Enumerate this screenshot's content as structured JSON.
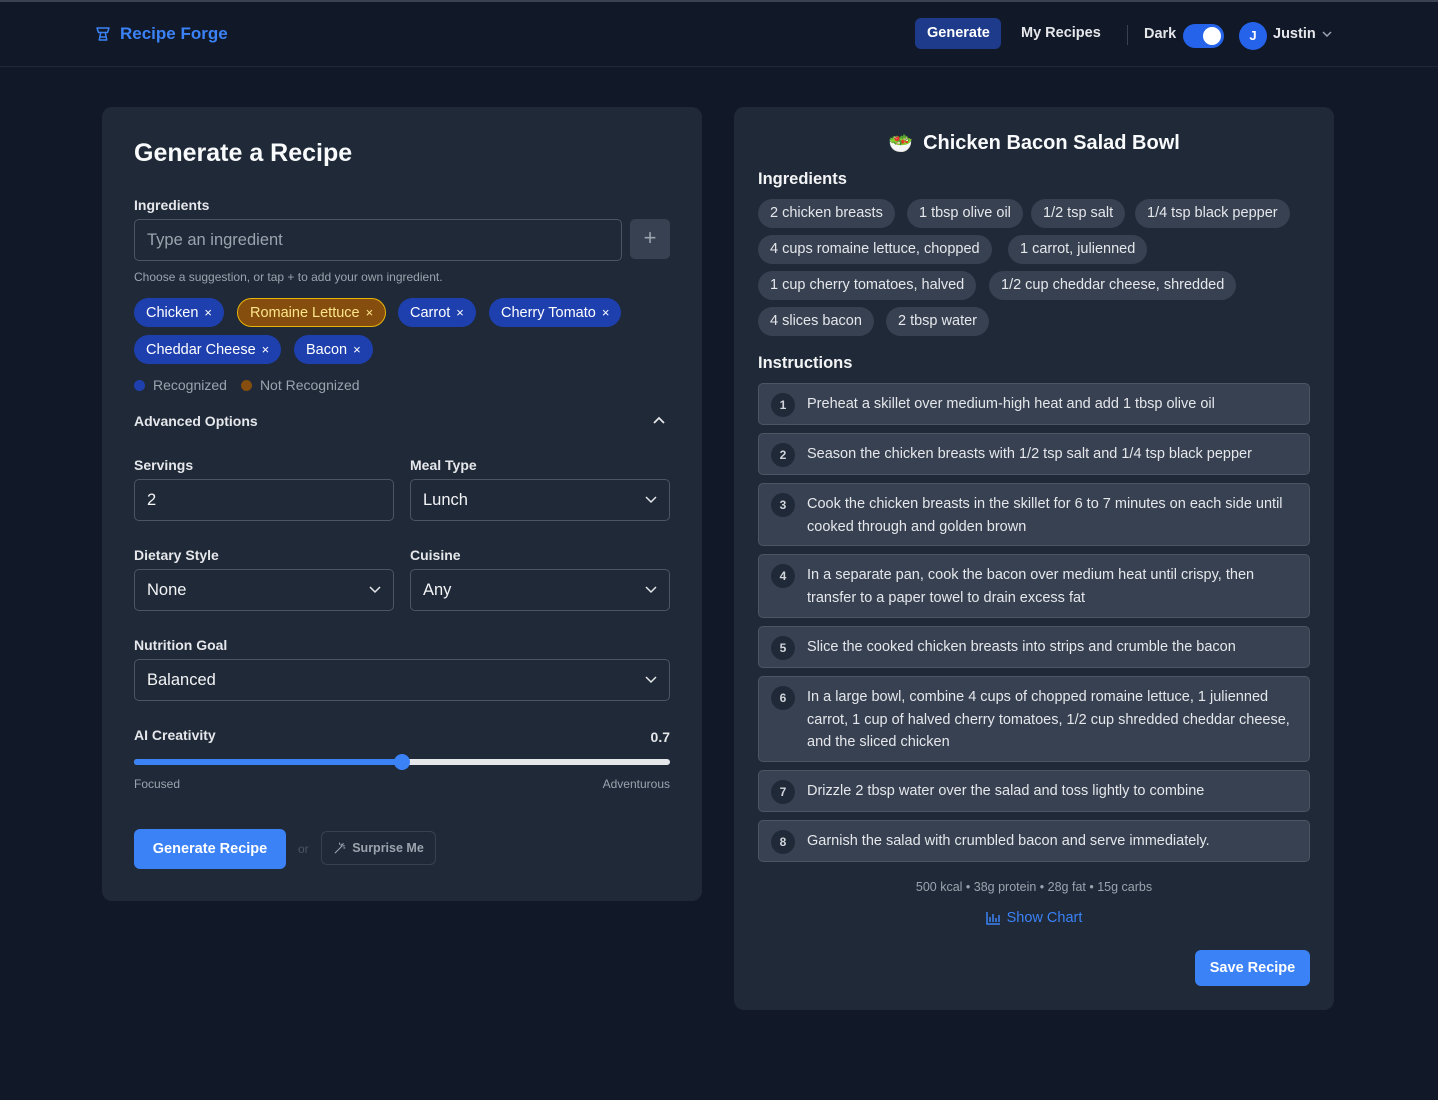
{
  "app": {
    "name": "Recipe Forge"
  },
  "nav": {
    "generate": "Generate",
    "my_recipes": "My Recipes",
    "dark_label": "Dark",
    "dark_on": true
  },
  "user": {
    "initial": "J",
    "name": "Justin"
  },
  "form": {
    "title": "Generate a Recipe",
    "ingredients_label": "Ingredients",
    "ingredient_placeholder": "Type an ingredient",
    "add_symbol": "+",
    "hint": "Choose a suggestion, or tap + to add your own ingredient.",
    "chips": [
      {
        "label": "Chicken",
        "recognized": true
      },
      {
        "label": "Romaine Lettuce",
        "recognized": false
      },
      {
        "label": "Carrot",
        "recognized": true
      },
      {
        "label": "Cherry Tomato",
        "recognized": true
      },
      {
        "label": "Cheddar Cheese",
        "recognized": true
      },
      {
        "label": "Bacon",
        "recognized": true
      }
    ],
    "remove_symbol": "×",
    "legend_recognized": "Recognized",
    "legend_not_recognized": "Not Recognized",
    "advanced_label": "Advanced Options",
    "servings_label": "Servings",
    "servings_value": "2",
    "meal_type_label": "Meal Type",
    "meal_type_value": "Lunch",
    "dietary_label": "Dietary Style",
    "dietary_value": "None",
    "cuisine_label": "Cuisine",
    "cuisine_value": "Any",
    "nutrition_label": "Nutrition Goal",
    "nutrition_value": "Balanced",
    "creativity_label": "AI Creativity",
    "creativity_value": "0.7",
    "creativity_fraction": 0.5,
    "slider_min_label": "Focused",
    "slider_max_label": "Adventurous",
    "generate_button": "Generate Recipe",
    "or_text": "or",
    "surprise_button": "Surprise Me"
  },
  "recipe": {
    "emoji": "🥗",
    "title": "Chicken Bacon Salad Bowl",
    "ingredients_title": "Ingredients",
    "ingredients": [
      "2 chicken breasts",
      "1 tbsp olive oil",
      "1/2 tsp salt",
      "1/4 tsp black pepper",
      "4 cups romaine lettuce, chopped",
      "1 carrot, julienned",
      "1 cup cherry tomatoes, halved",
      "1/2 cup cheddar cheese, shredded",
      "4 slices bacon",
      "2 tbsp water"
    ],
    "instructions_title": "Instructions",
    "steps": [
      "Preheat a skillet over medium-high heat and add 1 tbsp olive oil",
      "Season the chicken breasts with 1/2 tsp salt and 1/4 tsp black pepper",
      "Cook the chicken breasts in the skillet for 6 to 7 minutes on each side until cooked through and golden brown",
      "In a separate pan, cook the bacon over medium heat until crispy, then transfer to a paper towel to drain excess fat",
      "Slice the cooked chicken breasts into strips and crumble the bacon",
      "In a large bowl, combine 4 cups of chopped romaine lettuce, 1 julienned carrot, 1 cup of halved cherry tomatoes, 1/2 cup shredded cheddar cheese, and the sliced chicken",
      "Drizzle 2 tbsp water over the salad and toss lightly to combine",
      "Garnish the salad with crumbled bacon and serve immediately."
    ],
    "nutrition": "500 kcal • 38g protein • 28g fat • 15g carbs",
    "show_chart": "Show Chart",
    "save_button": "Save Recipe"
  },
  "colors": {
    "accent": "#3b82f6",
    "recognized": "#1e40af",
    "not_recognized": "#854d0e",
    "background": "#111827",
    "panel": "#1f2937"
  }
}
